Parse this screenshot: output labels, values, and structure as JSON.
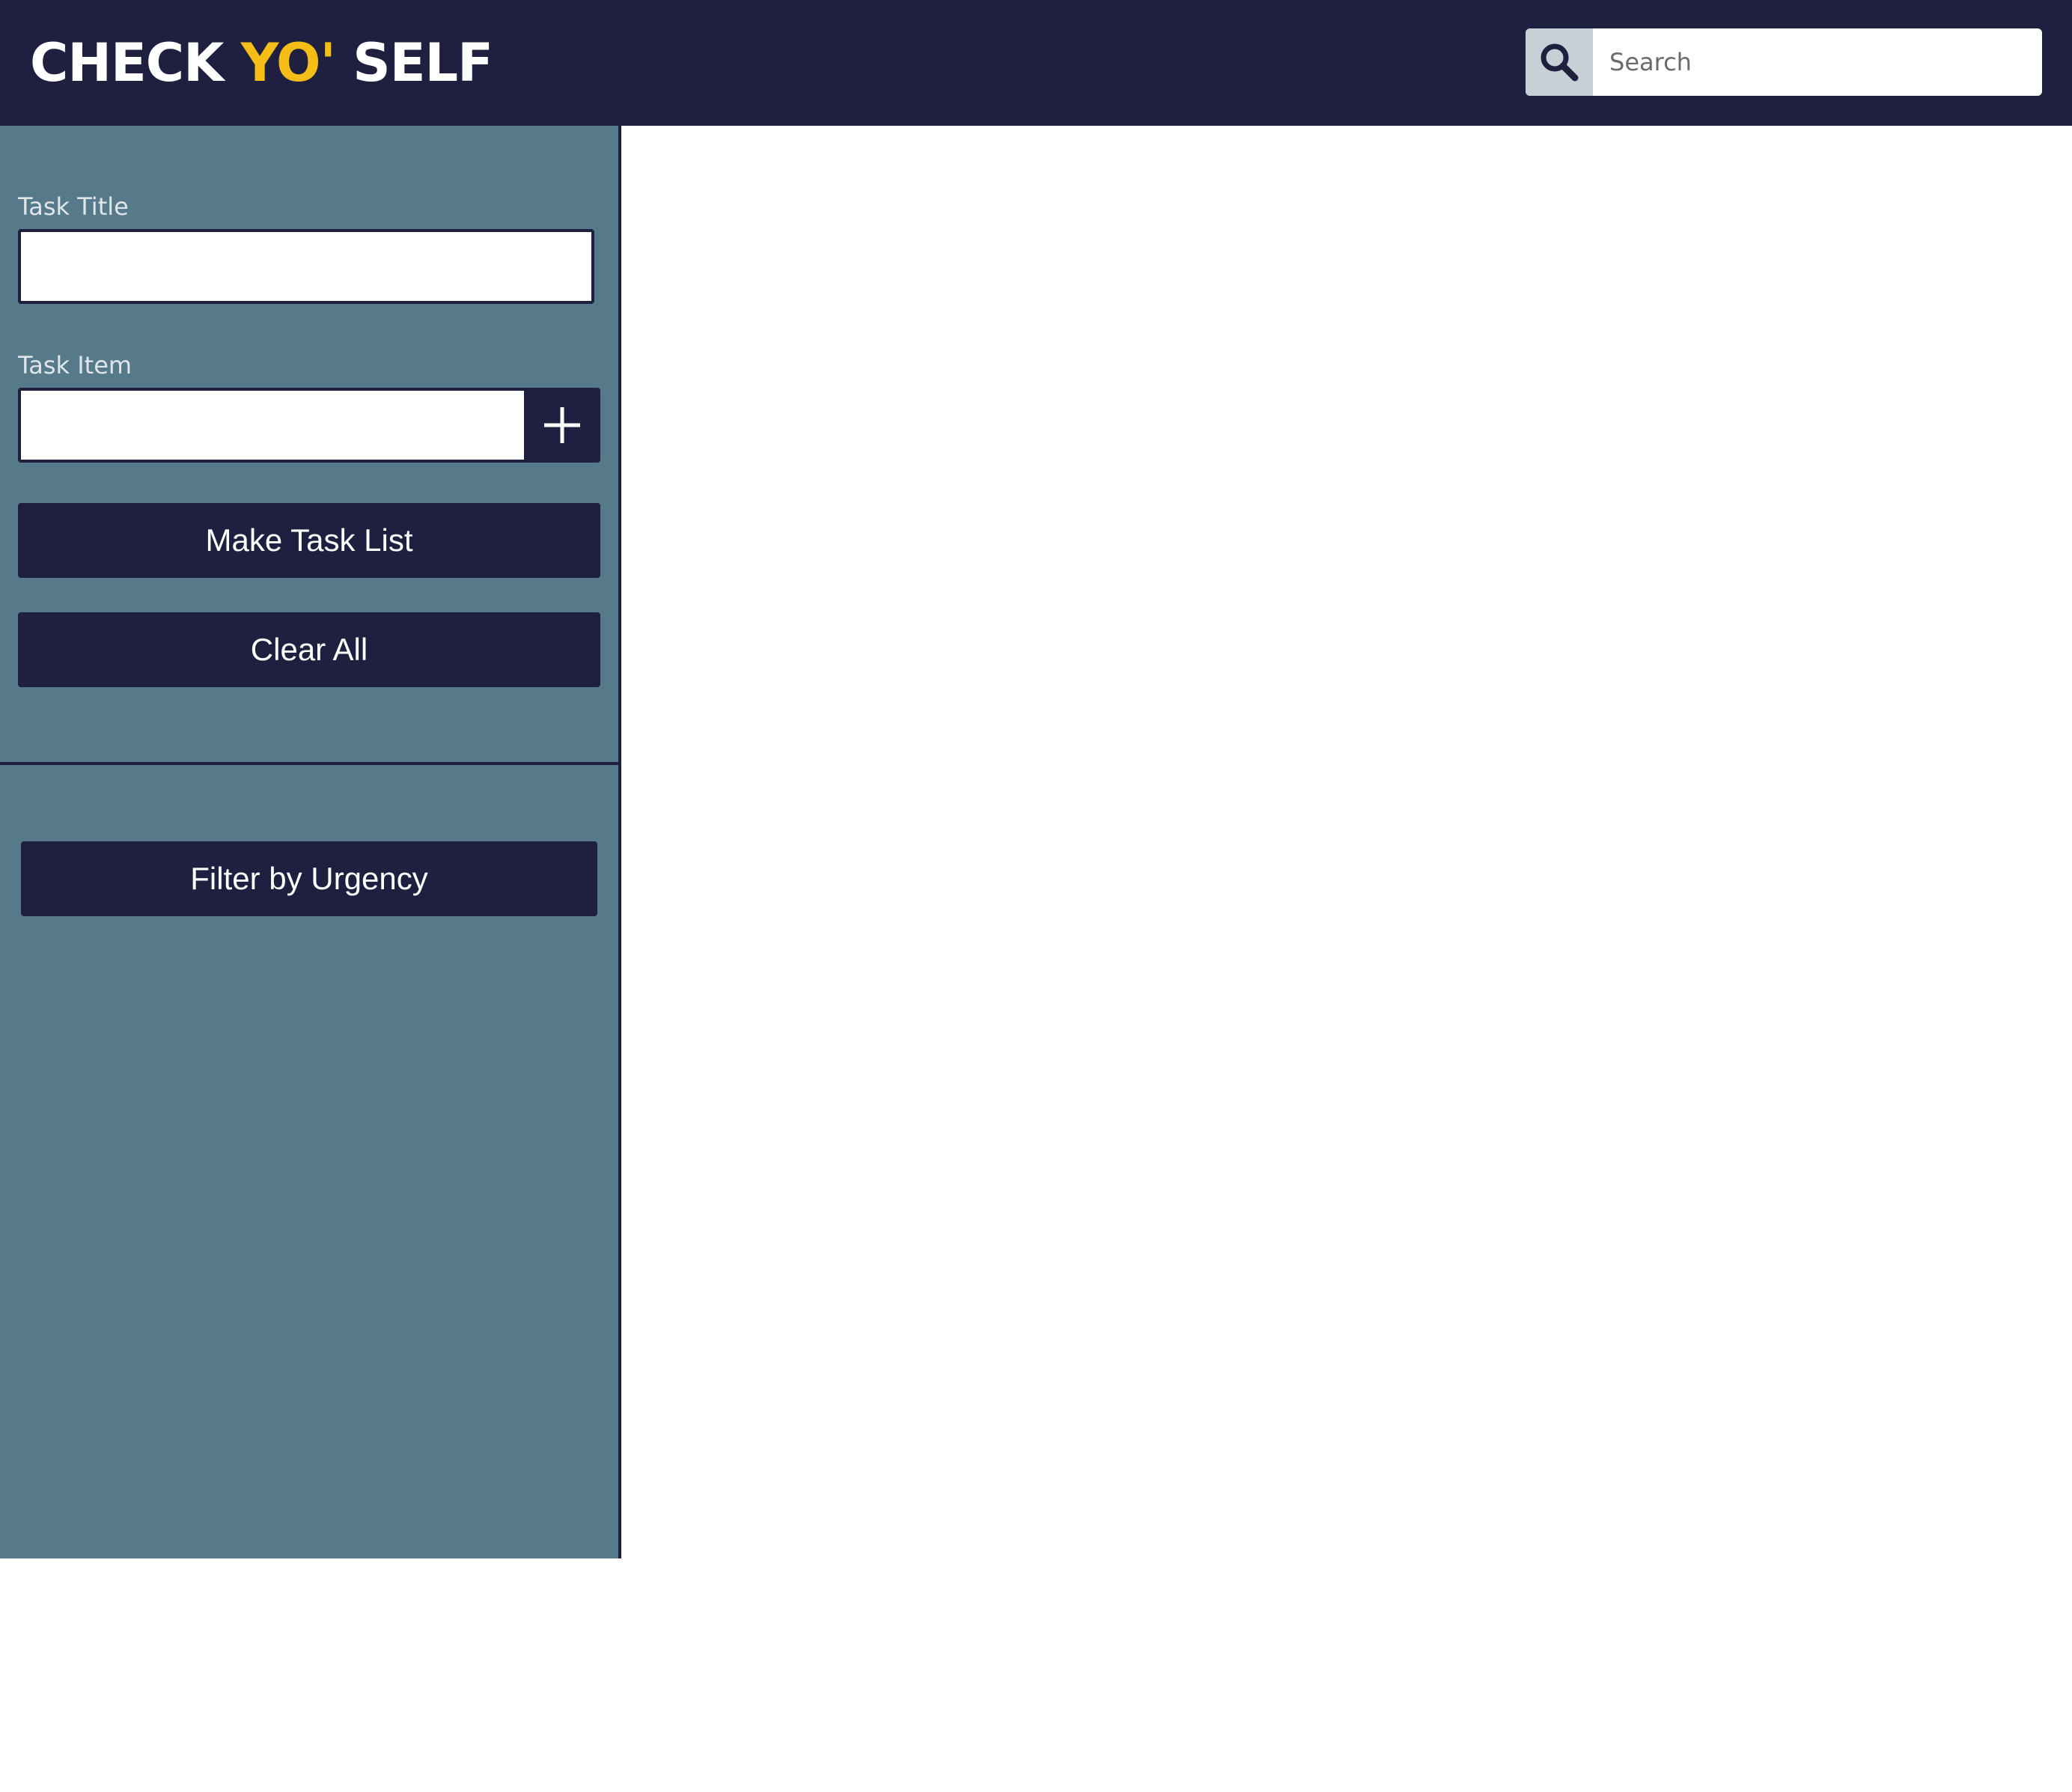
{
  "header": {
    "logo": {
      "part1": "CHECK ",
      "accent": "YO'",
      "part2": " SELF"
    },
    "search": {
      "icon": "search-icon",
      "placeholder": "Search",
      "value": ""
    }
  },
  "sidebar": {
    "task_title": {
      "label": "Task Title",
      "value": ""
    },
    "task_item": {
      "label": "Task Item",
      "value": "",
      "add_icon": "plus-icon"
    },
    "make_task_list_label": "Make Task List",
    "clear_all_label": "Clear All",
    "filter_label": "Filter by Urgency"
  },
  "colors": {
    "header_bg": "#1f1f3f",
    "accent": "#f5be17",
    "sidebar_bg": "#577a8a",
    "button_bg": "#1f1f3f",
    "search_button_bg": "#c7d0d6"
  }
}
